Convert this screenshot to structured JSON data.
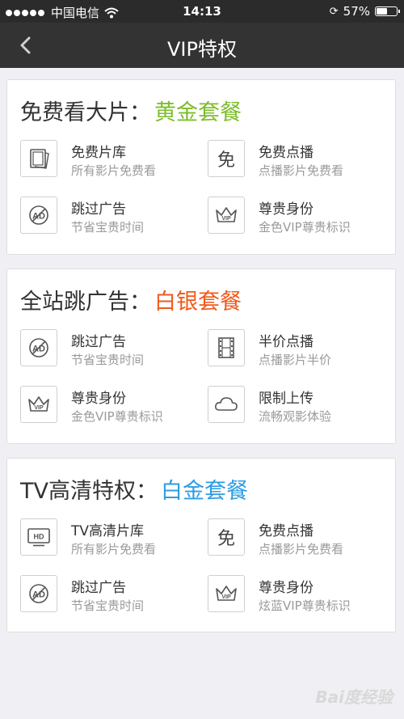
{
  "status_bar": {
    "carrier": "中国电信",
    "time": "14:13",
    "battery": "57%",
    "battery_level": 0.57
  },
  "nav": {
    "title": "VIP特权",
    "back_icon": "chevron-left-icon"
  },
  "colors": {
    "gold": "#7cbd2a",
    "silver": "#f05a1a",
    "platinum": "#2d9ce3",
    "navbar": "#333333"
  },
  "packages": [
    {
      "title": "免费看大片：",
      "tier": "黄金套餐",
      "tier_color": "#7cbd2a",
      "features": [
        {
          "icon": "film-library-icon",
          "title": "免费片库",
          "subtitle": "所有影片免费看"
        },
        {
          "icon": "free-icon",
          "title": "免费点播",
          "subtitle": "点播影片免费看"
        },
        {
          "icon": "skip-ad-icon",
          "title": "跳过广告",
          "subtitle": "节省宝贵时间"
        },
        {
          "icon": "vip-crown-icon",
          "title": "尊贵身份",
          "subtitle": "金色VIP尊贵标识"
        }
      ]
    },
    {
      "title": "全站跳广告：",
      "tier": "白银套餐",
      "tier_color": "#f05a1a",
      "features": [
        {
          "icon": "skip-ad-icon",
          "title": "跳过广告",
          "subtitle": "节省宝贵时间"
        },
        {
          "icon": "film-strip-icon",
          "title": "半价点播",
          "subtitle": "点播影片半价"
        },
        {
          "icon": "vip-crown-icon",
          "title": "尊贵身份",
          "subtitle": "金色VIP尊贵标识"
        },
        {
          "icon": "cloud-icon",
          "title": "限制上传",
          "subtitle": "流畅观影体验"
        }
      ]
    },
    {
      "title": "TV高清特权：",
      "tier": "白金套餐",
      "tier_color": "#2d9ce3",
      "features": [
        {
          "icon": "hd-tv-icon",
          "title": "TV高清片库",
          "subtitle": "所有影片免费看"
        },
        {
          "icon": "free-icon",
          "title": "免费点播",
          "subtitle": "点播影片免费看"
        },
        {
          "icon": "skip-ad-icon",
          "title": "跳过广告",
          "subtitle": "节省宝贵时间"
        },
        {
          "icon": "vip-crown-icon",
          "title": "尊贵身份",
          "subtitle": "炫蓝VIP尊贵标识"
        }
      ]
    }
  ],
  "watermark": "Bai度经验"
}
